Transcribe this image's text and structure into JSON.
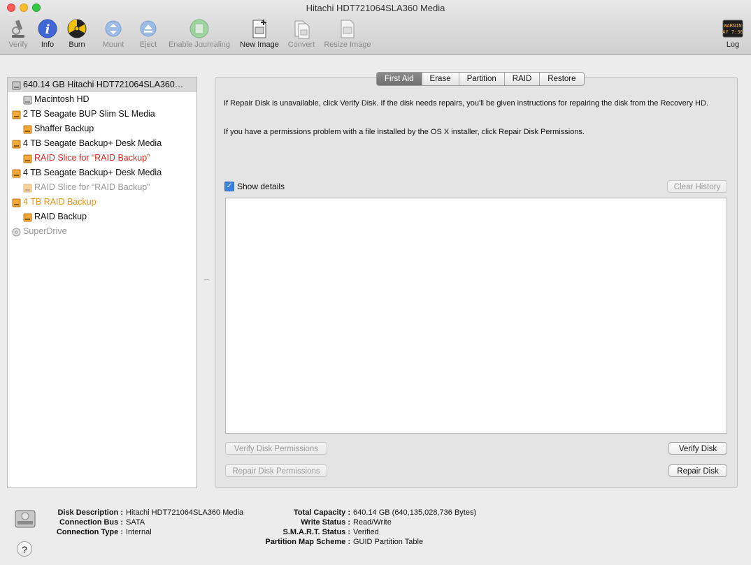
{
  "window": {
    "title": "Hitachi HDT721064SLA360 Media"
  },
  "toolbar": {
    "verify": "Verify",
    "info": "Info",
    "burn": "Burn",
    "mount": "Mount",
    "eject": "Eject",
    "enable_journaling": "Enable Journaling",
    "new_image": "New Image",
    "convert": "Convert",
    "resize_image": "Resize Image",
    "log": "Log",
    "log_icon_text_1": "WARNIN",
    "log_icon_text_2": "AY 7:36"
  },
  "sidebar": {
    "items": [
      {
        "label": "640.14 GB Hitachi HDT721064SLA360…",
        "icon": "internal-disk-icon",
        "color": "#111111"
      },
      {
        "label": "Macintosh HD",
        "icon": "internal-volume-icon",
        "color": "#111111"
      },
      {
        "label": "2 TB Seagate BUP Slim SL Media",
        "icon": "external-disk-icon",
        "color": "#111111"
      },
      {
        "label": "Shaffer Backup",
        "icon": "external-volume-icon",
        "color": "#111111"
      },
      {
        "label": "4 TB Seagate Backup+ Desk Media",
        "icon": "external-disk-icon",
        "color": "#111111"
      },
      {
        "label": "RAID Slice for “RAID Backup”",
        "icon": "external-volume-icon",
        "color": "#e0271f"
      },
      {
        "label": "4 TB Seagate Backup+ Desk Media",
        "icon": "external-disk-icon",
        "color": "#111111"
      },
      {
        "label": "RAID Slice for “RAID Backup”",
        "icon": "external-volume-icon",
        "color": "#999999"
      },
      {
        "label": "4 TB RAID Backup",
        "icon": "raid-disk-icon",
        "color": "#e8911b"
      },
      {
        "label": "RAID Backup",
        "icon": "raid-volume-icon",
        "color": "#111111"
      },
      {
        "label": "SuperDrive",
        "icon": "optical-drive-icon",
        "color": "#999999"
      }
    ]
  },
  "tabs": [
    "First Aid",
    "Erase",
    "Partition",
    "RAID",
    "Restore"
  ],
  "first_aid": {
    "para1": "If Repair Disk is unavailable, click Verify Disk. If the disk needs repairs, you'll be given instructions for repairing the disk from the Recovery HD.",
    "para2": "If you have a permissions problem with a file installed by the OS X installer, click Repair Disk Permissions.",
    "show_details": "Show details",
    "clear_history": "Clear History",
    "verify_permissions": "Verify Disk Permissions",
    "repair_permissions": "Repair Disk Permissions",
    "verify_disk": "Verify Disk",
    "repair_disk": "Repair Disk"
  },
  "info": {
    "left": [
      {
        "key": "Disk Description :",
        "value": "Hitachi HDT721064SLA360 Media"
      },
      {
        "key": "Connection Bus :",
        "value": "SATA"
      },
      {
        "key": "Connection Type :",
        "value": "Internal"
      }
    ],
    "right": [
      {
        "key": "Total Capacity :",
        "value": "640.14 GB (640,135,028,736 Bytes)"
      },
      {
        "key": "Write Status :",
        "value": "Read/Write"
      },
      {
        "key": "S.M.A.R.T. Status :",
        "value": "Verified"
      },
      {
        "key": "Partition Map Scheme :",
        "value": "GUID Partition Table"
      }
    ],
    "help": "?"
  }
}
